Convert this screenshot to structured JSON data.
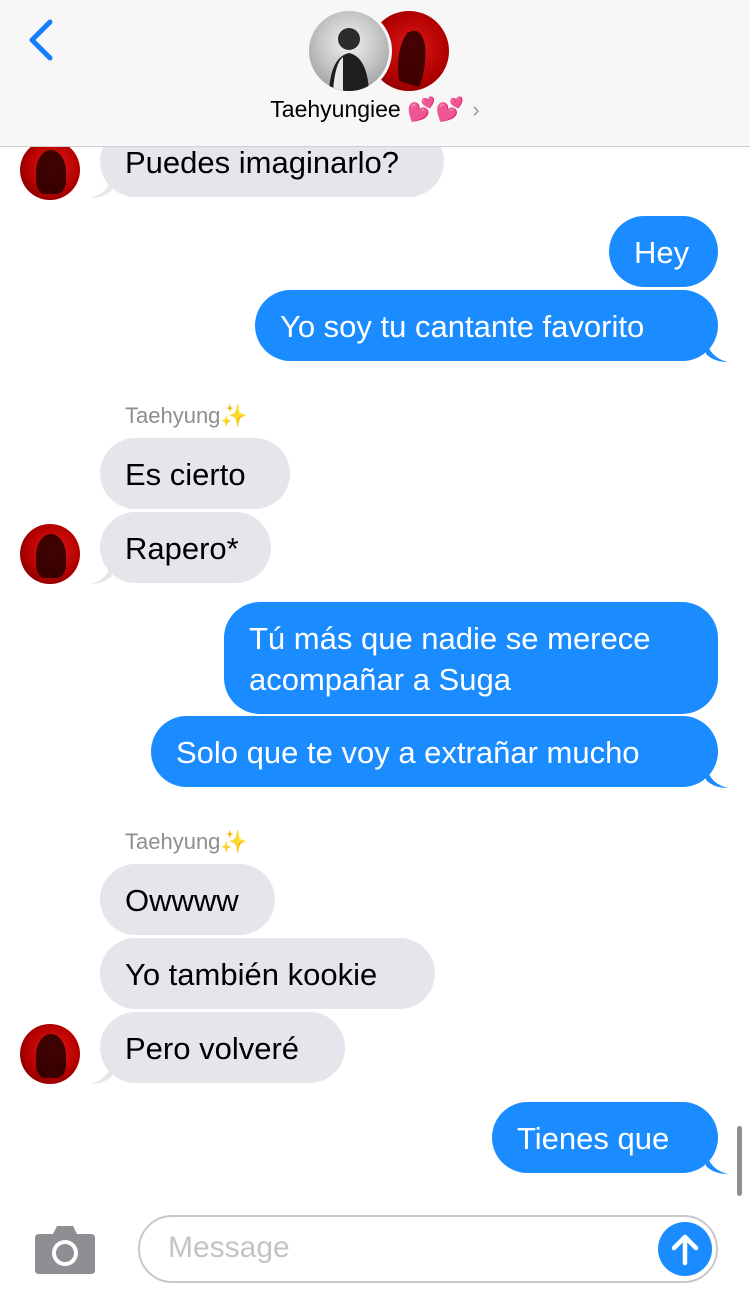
{
  "header": {
    "back_icon": "chevron-left-icon",
    "contact_name": "Taehyungiee 💕💕",
    "chevron": "›"
  },
  "messages": [
    {
      "dir": "in",
      "text": "Puedes imaginarlo?"
    },
    {
      "dir": "out",
      "text": "Hey"
    },
    {
      "dir": "out",
      "text": "Yo soy tu cantante favorito"
    },
    {
      "dir": "sender",
      "text": "Taehyung✨"
    },
    {
      "dir": "in",
      "text": "Es cierto"
    },
    {
      "dir": "in",
      "text": "Rapero*"
    },
    {
      "dir": "out",
      "text": "Tú más que nadie se merece acompañar a Suga"
    },
    {
      "dir": "out",
      "text": "Solo que te voy a extrañar mucho"
    },
    {
      "dir": "sender",
      "text": "Taehyung✨"
    },
    {
      "dir": "in",
      "text": "Owwww"
    },
    {
      "dir": "in",
      "text": "Yo también kookie"
    },
    {
      "dir": "in",
      "text": "Pero volveré"
    },
    {
      "dir": "out",
      "text": "Tienes que"
    }
  ],
  "composer": {
    "placeholder": "Message",
    "camera_icon": "camera-icon",
    "send_icon": "send-arrow-icon"
  },
  "colors": {
    "outgoing": "#1a8cff",
    "incoming": "#e6e5eb",
    "accent": "#147efb"
  }
}
